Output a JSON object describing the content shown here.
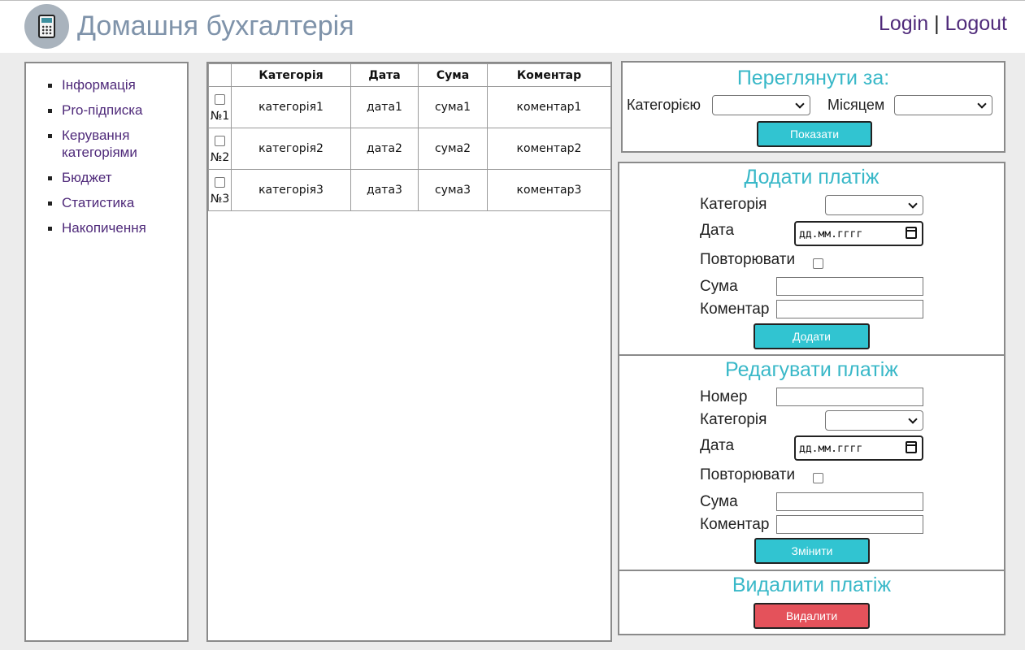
{
  "header": {
    "title": "Домашня бухгалтерія",
    "login": "Login",
    "separator": "|",
    "logout": "Logout",
    "logo_icon": "calculator-icon"
  },
  "sidebar": {
    "items": [
      {
        "label": "Інформація"
      },
      {
        "label": "Pro-підписка"
      },
      {
        "label": "Керування категоріями"
      },
      {
        "label": "Бюджет"
      },
      {
        "label": "Статистика"
      },
      {
        "label": "Накопичення"
      }
    ]
  },
  "table": {
    "headers": [
      "Категорія",
      "Дата",
      "Сума",
      "Коментар"
    ],
    "rows": [
      {
        "num": "№1",
        "category": "категорія1",
        "date": "дата1",
        "sum": "сума1",
        "comment": "коментар1"
      },
      {
        "num": "№2",
        "category": "категорія2",
        "date": "дата2",
        "sum": "сума2",
        "comment": "коментар2"
      },
      {
        "num": "№3",
        "category": "категорія3",
        "date": "дата3",
        "sum": "сума3",
        "comment": "коментар3"
      }
    ]
  },
  "view": {
    "title": "Переглянути за:",
    "category_label": "Категорією",
    "category_value": "",
    "month_label": "Місяцем",
    "month_value": "",
    "button": "Показати"
  },
  "add": {
    "title": "Додати платіж",
    "category_label": "Категорія",
    "category_value": "",
    "date_label": "Дата",
    "date_placeholder": "дд.мм.гггг",
    "repeat_label": "Повторювати",
    "sum_label": "Сума",
    "sum_value": "",
    "comment_label": "Коментар",
    "comment_value": "",
    "button": "Додати"
  },
  "edit": {
    "title": "Редагувати платіж",
    "number_label": "Номер",
    "number_value": "",
    "category_label": "Категорія",
    "category_value": "",
    "date_label": "Дата",
    "date_placeholder": "дд.мм.гггг",
    "repeat_label": "Повторювати",
    "sum_label": "Сума",
    "sum_value": "",
    "comment_label": "Коментар",
    "comment_value": "",
    "button": "Змінити"
  },
  "delete": {
    "title": "Видалити платіж",
    "button": "Видалити"
  },
  "colors": {
    "accent": "#39b8c8",
    "button_primary": "#31c4d1",
    "button_danger": "#e4525b",
    "link": "#4f2a7a",
    "title": "#7f93aa"
  }
}
